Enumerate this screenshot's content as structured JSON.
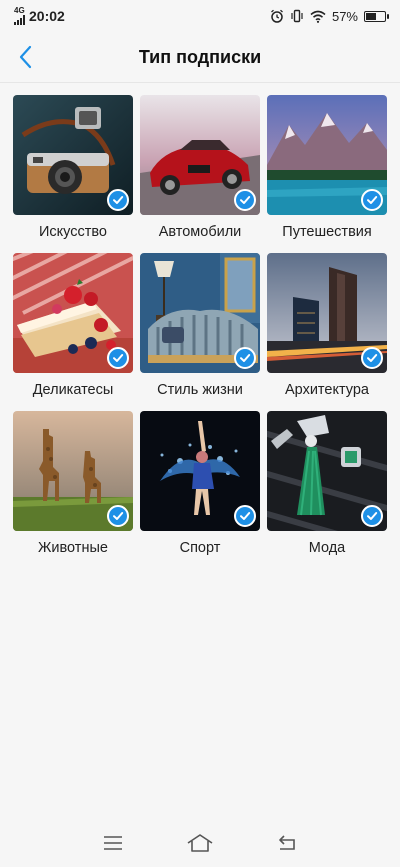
{
  "status": {
    "network": "4G",
    "time": "20:02",
    "battery_text": "57%",
    "battery_level": 0.57
  },
  "header": {
    "title": "Тип подписки",
    "back_icon": "chevron-left-icon"
  },
  "categories": [
    {
      "label": "Искусство",
      "selected": true,
      "image": "vintage-camera"
    },
    {
      "label": "Автомобили",
      "selected": true,
      "image": "red-sports-car"
    },
    {
      "label": "Путешествия",
      "selected": true,
      "image": "mountain-lake"
    },
    {
      "label": "Деликатесы",
      "selected": true,
      "image": "berry-cake"
    },
    {
      "label": "Стиль жизни",
      "selected": true,
      "image": "striped-sofa"
    },
    {
      "label": "Архитектура",
      "selected": true,
      "image": "skyscrapers"
    },
    {
      "label": "Животные",
      "selected": true,
      "image": "giraffes"
    },
    {
      "label": "Спорт",
      "selected": true,
      "image": "swimmer-splash"
    },
    {
      "label": "Мода",
      "selected": true,
      "image": "emerald-jewelry"
    }
  ],
  "nav": {
    "menu_icon": "menu-icon",
    "home_icon": "home-icon",
    "back_icon": "back-arrow-icon"
  },
  "colors": {
    "accent": "#1e90e6",
    "background": "#f6f6f6"
  }
}
